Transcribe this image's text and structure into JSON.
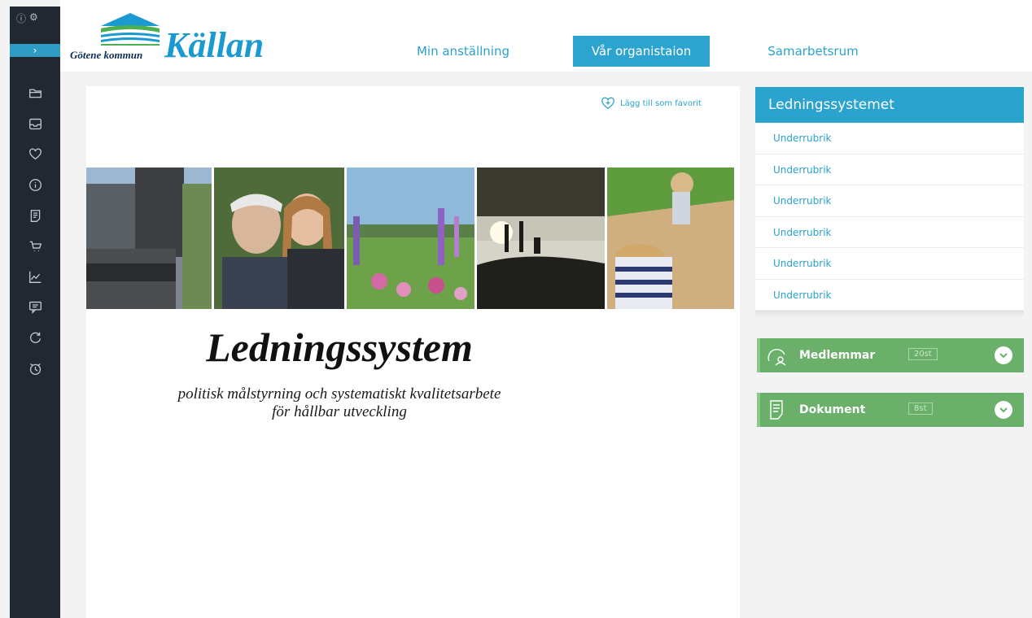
{
  "colors": {
    "sidebar_bg": "#222831",
    "accent_blue": "#2ca4cf",
    "green_bar": "#6aaf6a",
    "page_bg": "#f3f3f3"
  },
  "sidebar": {
    "top_icons": [
      "info-icon",
      "settings-icon"
    ],
    "toggle_label": "›",
    "items": [
      {
        "icon": "folder-icon"
      },
      {
        "icon": "inbox-icon"
      },
      {
        "icon": "heart-icon"
      },
      {
        "icon": "info-icon"
      },
      {
        "icon": "document-icon"
      },
      {
        "icon": "cart-icon"
      },
      {
        "icon": "chart-icon"
      },
      {
        "icon": "chat-icon"
      },
      {
        "icon": "refresh-icon"
      },
      {
        "icon": "alarm-icon"
      }
    ]
  },
  "header": {
    "logo_municipality": "Götene kommun",
    "logo_name": "Källan",
    "nav": [
      {
        "label": "Min anställning",
        "active": false
      },
      {
        "label": "Vår organistaion",
        "active": true
      },
      {
        "label": "Samarbetsrum",
        "active": false
      }
    ]
  },
  "main": {
    "favorite_label": "Lägg till som favorit",
    "photos": [
      "street-sweeper-photo",
      "elderly-couple-photo",
      "lupin-meadow-photo",
      "lake-sunset-photo",
      "child-sandbox-photo"
    ],
    "title": "Ledningssystem",
    "subtitle_line1": "politisk målstyrning och systematiskt kvalitetsarbete",
    "subtitle_line2": "för hållbar utveckling"
  },
  "right_menu": {
    "heading": "Ledningssystemet",
    "items": [
      "Underrubrik",
      "Underrubrik",
      "Underrubrik",
      "Underrubrik",
      "Underrubrik",
      "Underrubrik"
    ]
  },
  "bars": [
    {
      "label": "Medlemmar",
      "count": "20st",
      "icon": "members-icon"
    },
    {
      "label": "Dokument",
      "count": "8st",
      "icon": "document-icon"
    }
  ]
}
